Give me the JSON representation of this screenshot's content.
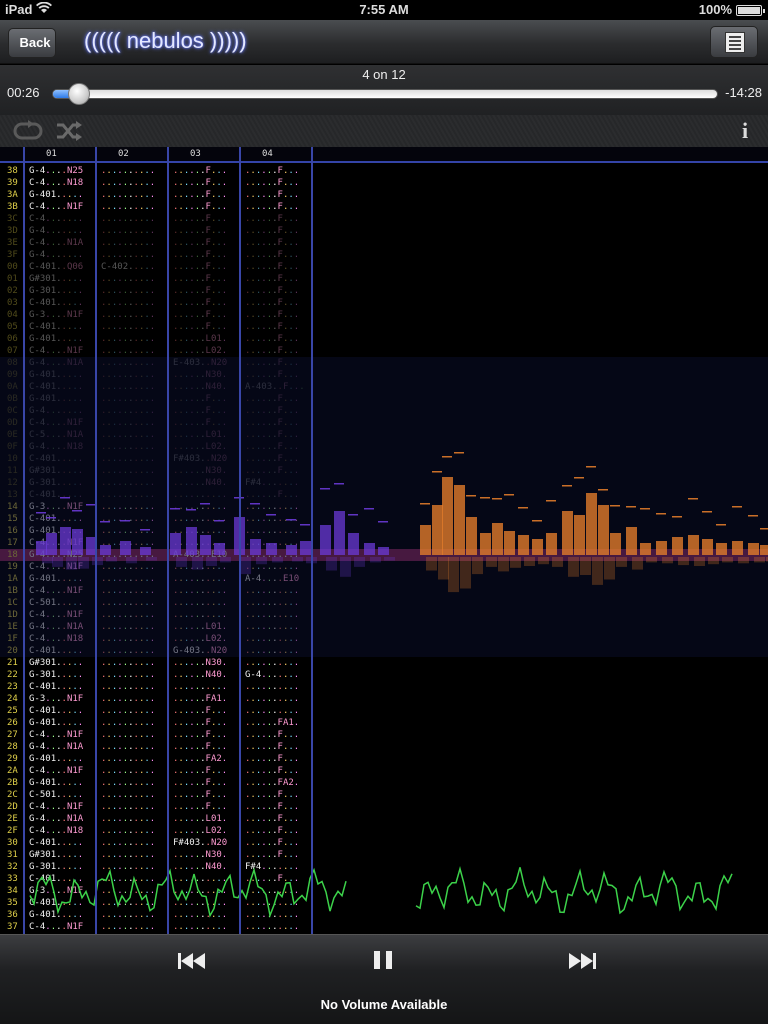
{
  "status": {
    "carrier": "iPad",
    "time": "7:55 AM",
    "battery": "100%"
  },
  "nav": {
    "back_label": "Back",
    "title": "((((( nebulos )))))"
  },
  "progress": {
    "track_position": "4 on 12",
    "elapsed": "00:26",
    "remaining": "-14:28",
    "fraction": 0.039
  },
  "icons": {
    "loop": "loop-icon",
    "shuffle": "shuffle-icon",
    "info": "info-icon",
    "playlist": "playlist-icon",
    "prev": "previous-track-icon",
    "pause": "pause-icon",
    "next": "next-track-icon"
  },
  "channels": [
    "01",
    "02",
    "03",
    "04"
  ],
  "colors": {
    "accent": "#3946a8",
    "highlight": "#92285e",
    "rownum": "#e0d04a",
    "spectrum": "#e07b2a",
    "wave": "#3cd24a"
  },
  "pattern_rows": [
    {
      "n": "38",
      "c": [
        "G-4....N25",
        "..........",
        "......F...",
        "......F..."
      ]
    },
    {
      "n": "39",
      "c": [
        "C-4....N18",
        "..........",
        "......F...",
        "......F..."
      ]
    },
    {
      "n": "3A",
      "c": [
        "G-401.....",
        "..........",
        "......F...",
        "......F..."
      ]
    },
    {
      "n": "3B",
      "c": [
        "C-4....N1F",
        "..........",
        "......F...",
        "......F..."
      ]
    },
    {
      "n": "3C",
      "c": [
        "C-4.......",
        "..........",
        "......F...",
        "......F..."
      ]
    },
    {
      "n": "3D",
      "c": [
        "G-4.......",
        "..........",
        "......F...",
        "......F..."
      ]
    },
    {
      "n": "3E",
      "c": [
        "C-4....N1A",
        "..........",
        "......F...",
        "......F..."
      ]
    },
    {
      "n": "3F",
      "c": [
        "G-4.......",
        "..........",
        "......F...",
        "......F..."
      ]
    },
    {
      "n": "00",
      "c": [
        "C-401..Q06",
        "C-402.....",
        "......F...",
        "......F..."
      ]
    },
    {
      "n": "01",
      "c": [
        "G#301.....",
        "..........",
        "......F...",
        "......F..."
      ]
    },
    {
      "n": "02",
      "c": [
        "G-301.....",
        "..........",
        "......F...",
        "......F..."
      ]
    },
    {
      "n": "03",
      "c": [
        "C-401.....",
        "..........",
        "......F...",
        "......F..."
      ]
    },
    {
      "n": "04",
      "c": [
        "G-3....N1F",
        "..........",
        "......F...",
        "......F..."
      ]
    },
    {
      "n": "05",
      "c": [
        "C-401.....",
        "..........",
        "......F...",
        "......F..."
      ]
    },
    {
      "n": "06",
      "c": [
        "G-401.....",
        "..........",
        "......L01.",
        "......F..."
      ]
    },
    {
      "n": "07",
      "c": [
        "C-4....N1F",
        "..........",
        "......L02.",
        "......F..."
      ]
    },
    {
      "n": "08",
      "c": [
        "G-4....N1A",
        "..........",
        "E-403..N20",
        "......F..."
      ]
    },
    {
      "n": "09",
      "c": [
        "G-401.....",
        "..........",
        "......N30.",
        "......F..."
      ]
    },
    {
      "n": "0A",
      "c": [
        "C-401.....",
        "..........",
        "......N40.",
        "A-403..F..."
      ]
    },
    {
      "n": "0B",
      "c": [
        "G-401.....",
        "..........",
        "......F...",
        "......F..."
      ]
    },
    {
      "n": "0C",
      "c": [
        "G-4.......",
        "..........",
        "......F...",
        "......F..."
      ]
    },
    {
      "n": "0D",
      "c": [
        "C-4....N1F",
        "..........",
        "......F...",
        "......F..."
      ]
    },
    {
      "n": "0E",
      "c": [
        "C-5....N1A",
        "..........",
        "......L01.",
        "......F..."
      ]
    },
    {
      "n": "0F",
      "c": [
        "G-4....N18",
        "..........",
        "......L02.",
        "......F..."
      ]
    },
    {
      "n": "10",
      "c": [
        "C-401.....",
        "..........",
        "F#403..N20",
        "......F..."
      ]
    },
    {
      "n": "11",
      "c": [
        "G#301.....",
        "..........",
        "......N30.",
        "......F..."
      ]
    },
    {
      "n": "12",
      "c": [
        "G-301.....",
        "..........",
        "......N40.",
        "F#4......."
      ]
    },
    {
      "n": "13",
      "c": [
        "C-401.....",
        "..........",
        "..........",
        "......F..."
      ]
    },
    {
      "n": "14",
      "c": [
        "G-3....N1F",
        "..........",
        "..........",
        ".........."
      ]
    },
    {
      "n": "15",
      "c": [
        "C-401.....",
        "..........",
        "..........",
        ".........."
      ]
    },
    {
      "n": "16",
      "c": [
        "G-401.....",
        "..........",
        "..........",
        ".........."
      ]
    },
    {
      "n": "17",
      "c": [
        "C-4....N1F",
        "..........",
        "..........",
        ".........."
      ]
    },
    {
      "n": "18",
      "c": [
        "G-4....N25",
        "..........",
        "A-403..E10",
        ".........."
      ]
    },
    {
      "n": "19",
      "c": [
        "C-4....N1F",
        "..........",
        "..........",
        ".........."
      ]
    },
    {
      "n": "1A",
      "c": [
        "G-401.....",
        "..........",
        "..........",
        "A-4....E10"
      ]
    },
    {
      "n": "1B",
      "c": [
        "C-4....N1F",
        "..........",
        "..........",
        ".........."
      ]
    },
    {
      "n": "1C",
      "c": [
        "C-501.....",
        "..........",
        "..........",
        ".........."
      ]
    },
    {
      "n": "1D",
      "c": [
        "C-4....N1F",
        "..........",
        "..........",
        ".........."
      ]
    },
    {
      "n": "1E",
      "c": [
        "G-4....N1A",
        "..........",
        "......L01.",
        ".........."
      ]
    },
    {
      "n": "1F",
      "c": [
        "C-4....N18",
        "..........",
        "......L02.",
        ".........."
      ]
    },
    {
      "n": "20",
      "c": [
        "C-401.....",
        "..........",
        "G-403..N20",
        ".........."
      ]
    },
    {
      "n": "21",
      "c": [
        "G#301.....",
        "..........",
        "......N30.",
        ".........."
      ]
    },
    {
      "n": "22",
      "c": [
        "G-301.....",
        "..........",
        "......N40.",
        "G-4......."
      ]
    },
    {
      "n": "23",
      "c": [
        "C-401.....",
        "..........",
        "..........",
        ".........."
      ]
    },
    {
      "n": "24",
      "c": [
        "G-3....N1F",
        "..........",
        "......FA1.",
        ".........."
      ]
    },
    {
      "n": "25",
      "c": [
        "C-401.....",
        "..........",
        "......F...",
        ".........."
      ]
    },
    {
      "n": "26",
      "c": [
        "G-401.....",
        "..........",
        "......F...",
        "......FA1."
      ]
    },
    {
      "n": "27",
      "c": [
        "C-4....N1F",
        "..........",
        "......F...",
        "......F..."
      ]
    },
    {
      "n": "28",
      "c": [
        "G-4....N1A",
        "..........",
        "......F...",
        "......F..."
      ]
    },
    {
      "n": "29",
      "c": [
        "G-401.....",
        "..........",
        "......FA2.",
        "......F..."
      ]
    },
    {
      "n": "2A",
      "c": [
        "C-4....N1F",
        "..........",
        "......F...",
        "......F..."
      ]
    },
    {
      "n": "2B",
      "c": [
        "G-401.....",
        "..........",
        "......F...",
        "......FA2."
      ]
    },
    {
      "n": "2C",
      "c": [
        "C-501.....",
        "..........",
        "......F...",
        "......F..."
      ]
    },
    {
      "n": "2D",
      "c": [
        "C-4....N1F",
        "..........",
        "......F...",
        "......F..."
      ]
    },
    {
      "n": "2E",
      "c": [
        "G-4....N1A",
        "..........",
        "......L01.",
        "......F..."
      ]
    },
    {
      "n": "2F",
      "c": [
        "C-4....N18",
        "..........",
        "......L02.",
        "......F..."
      ]
    },
    {
      "n": "30",
      "c": [
        "C-401.....",
        "..........",
        "F#403..N20",
        "......F..."
      ]
    },
    {
      "n": "31",
      "c": [
        "G#301.....",
        "..........",
        "......N30.",
        "......F..."
      ]
    },
    {
      "n": "32",
      "c": [
        "G-301.....",
        "..........",
        "......N40.",
        "F#4......."
      ]
    },
    {
      "n": "33",
      "c": [
        "C-401.....",
        "..........",
        "..........",
        "......F..."
      ]
    },
    {
      "n": "34",
      "c": [
        "G-3....N1F",
        "..........",
        "..........",
        ".........."
      ]
    },
    {
      "n": "35",
      "c": [
        "C-401.....",
        "..........",
        "..........",
        ".........."
      ]
    },
    {
      "n": "36",
      "c": [
        "G-401.....",
        "..........",
        "..........",
        ".........."
      ]
    },
    {
      "n": "37",
      "c": [
        "C-4....N1F",
        "..........",
        "..........",
        ".........."
      ]
    }
  ],
  "current_row": "18",
  "dim_rows": [
    "3C",
    "3D",
    "3E",
    "3F",
    "00",
    "01",
    "02",
    "03",
    "04",
    "05",
    "06",
    "07",
    "08",
    "09",
    "0A",
    "0B",
    "0C",
    "0D",
    "0E",
    "0F",
    "10",
    "11",
    "12",
    "13"
  ],
  "volume_label": "No Volume Available"
}
